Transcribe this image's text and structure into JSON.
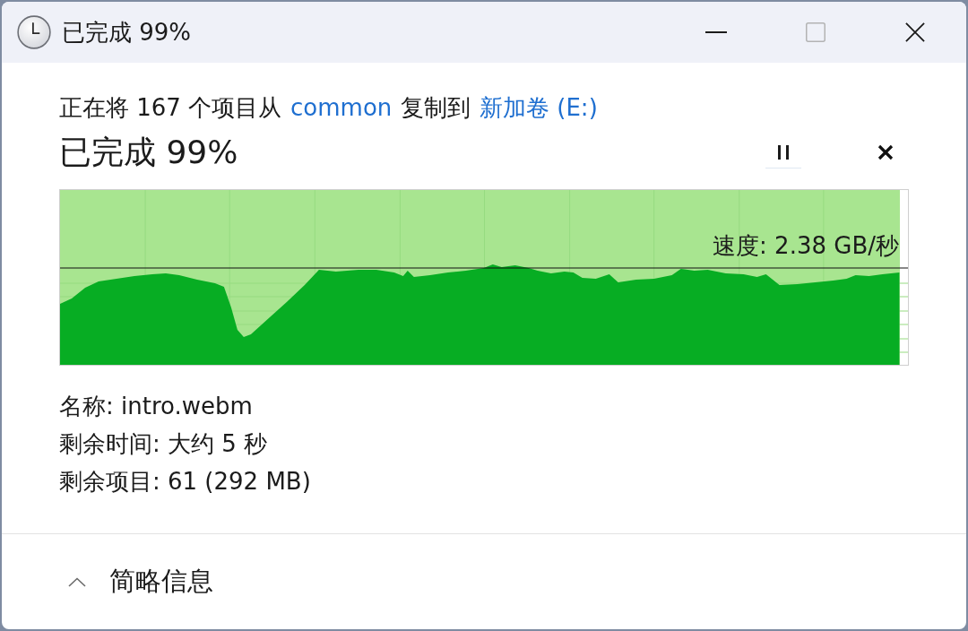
{
  "window": {
    "title": "已完成 99%"
  },
  "description": [
    {
      "kind": "text",
      "text": "正在将 167 个项目从"
    },
    {
      "kind": "link",
      "text": "common"
    },
    {
      "kind": "text",
      "text": "复制到"
    },
    {
      "kind": "link",
      "text": "新加卷 (E:)"
    }
  ],
  "status": "已完成 99%",
  "progress": {
    "level": 0.99,
    "speed": "速度: 2.38 GB/秒"
  },
  "details": [
    "名称: intro.webm",
    "剩余时间: 大约 5 秒",
    "剩余项目: 61 (292 MB)"
  ],
  "footer": {
    "toggle": "简略信息",
    "expanded": true
  }
}
